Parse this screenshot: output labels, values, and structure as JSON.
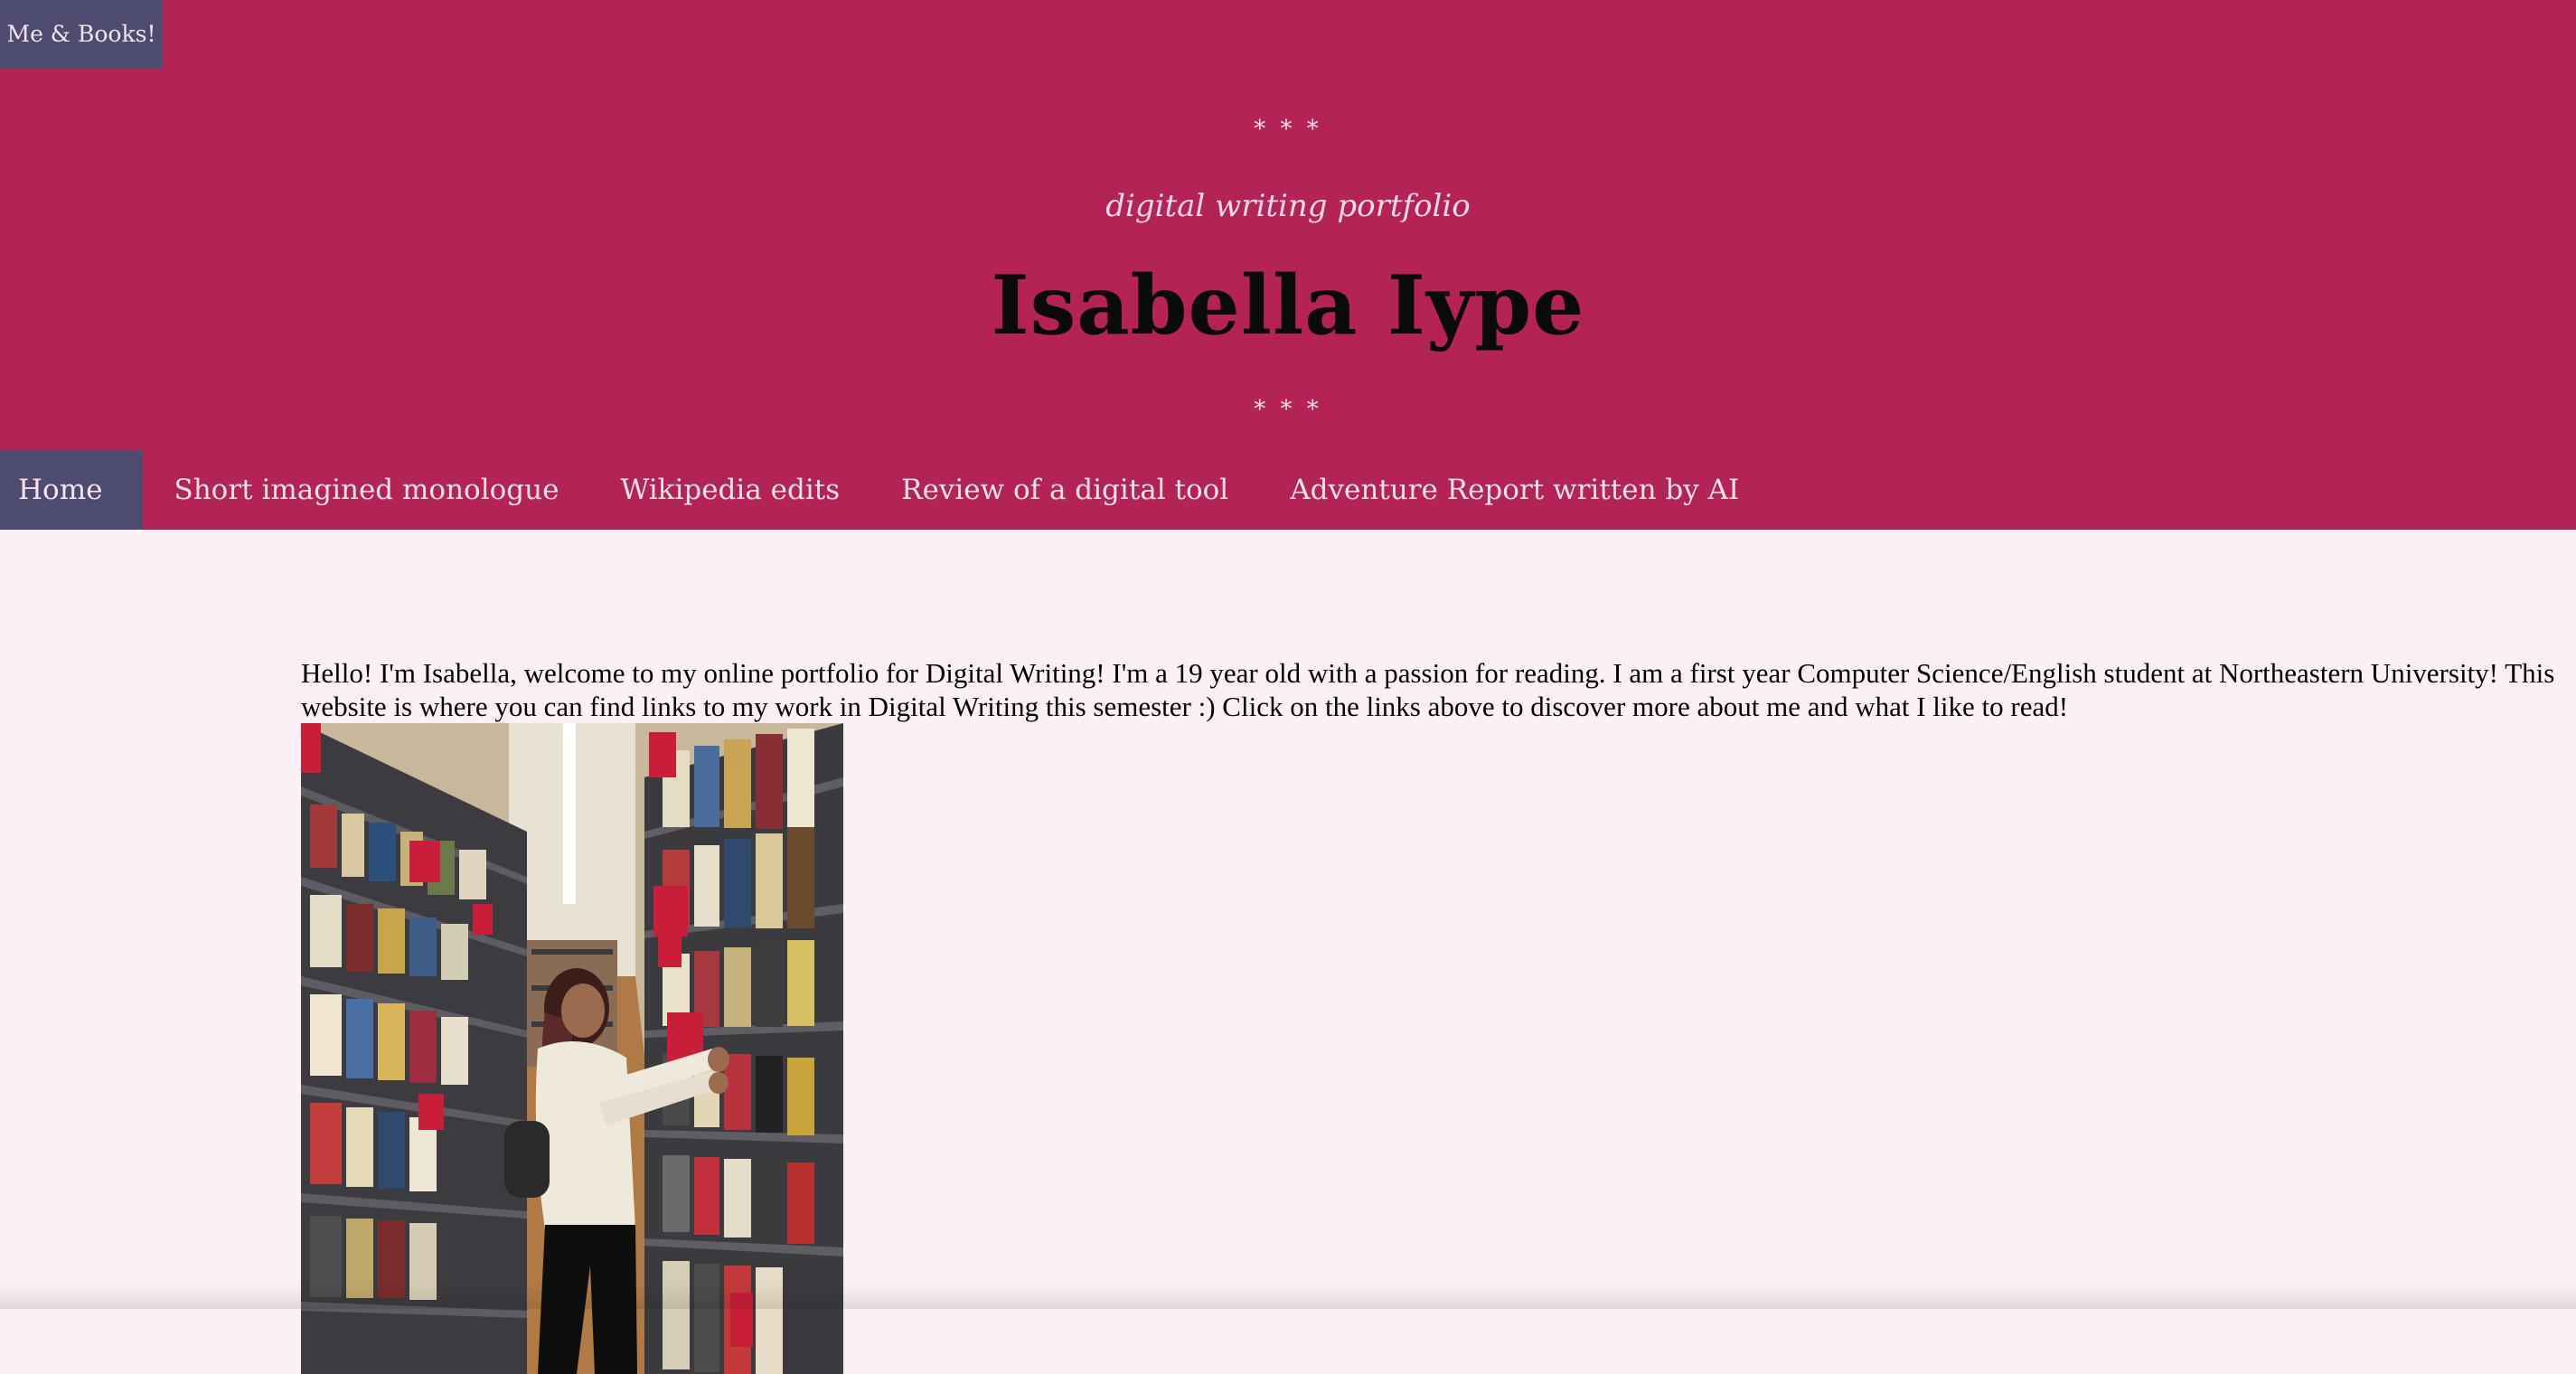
{
  "site_tab": {
    "label": "Me & Books!"
  },
  "header": {
    "stars_top": "* * *",
    "subtitle": "digital writing portfolio",
    "title": "Isabella Iype",
    "stars_bottom": "* * *"
  },
  "nav": {
    "items": [
      {
        "label": "Home",
        "active": true
      },
      {
        "label": "Short imagined monologue"
      },
      {
        "label": "Wikipedia edits"
      },
      {
        "label": "Review of a digital tool"
      },
      {
        "label": "Adventure Report written by AI"
      }
    ]
  },
  "main": {
    "intro": "Hello! I'm Isabella, welcome to my online portfolio for Digital Writing! I'm a 19 year old with a passion for reading. I am a first year Computer Science/English student at Northeastern University! This website is where you can find links to my work in Digital Writing this semester :) Click on the links above to discover more about me and what I like to read!"
  },
  "colors": {
    "header_bg": "#b42356",
    "active_bg": "#4d4b6f",
    "page_bg": "#fbf0f5"
  }
}
